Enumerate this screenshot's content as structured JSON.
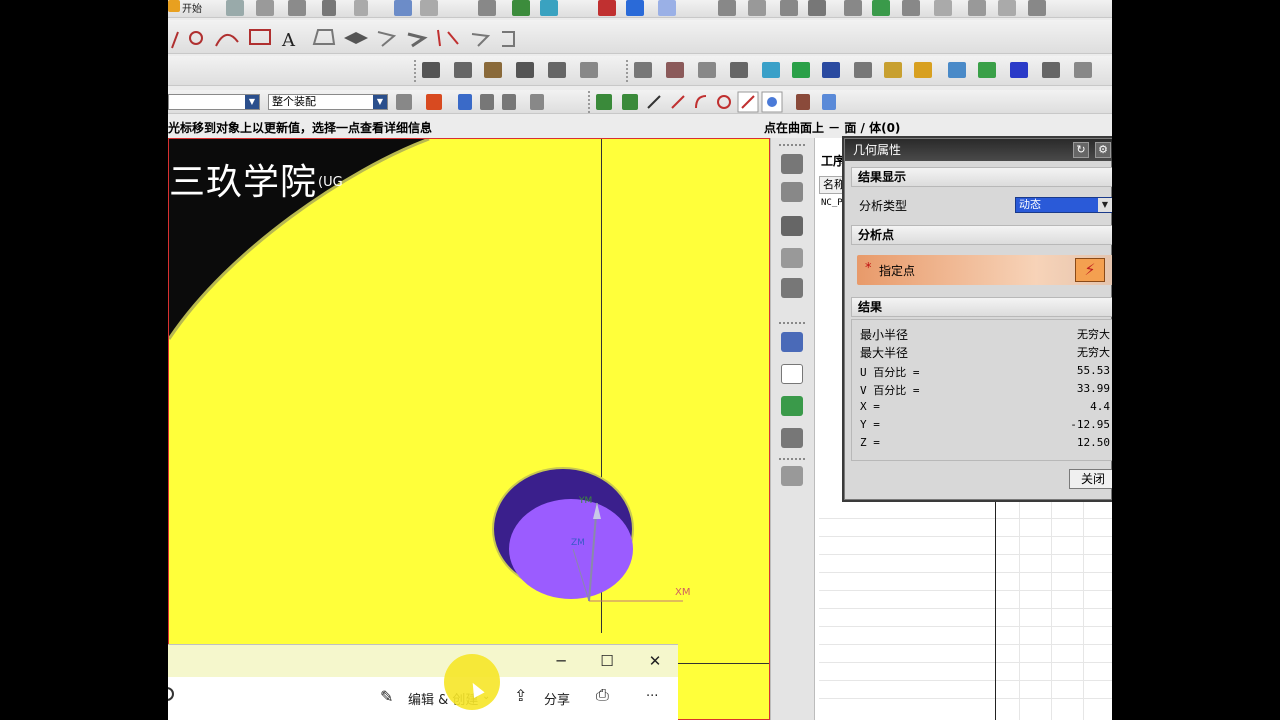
{
  "menu": {
    "start_label": "开始"
  },
  "toolbar": {
    "assembly_combo": "整个装配"
  },
  "status": {
    "left_message": "光标移到对象上以更新值，选择一点查看详细信息",
    "right_message": "点在曲面上 － 面 / 体(0)"
  },
  "viewport": {
    "brand_text": "三玖学院",
    "brand_sub": "(UG"
  },
  "navigator": {
    "title": "工序",
    "col_name": "名称",
    "row0": "NC_P"
  },
  "dialog": {
    "title": "几何属性",
    "section_result_display": "结果显示",
    "analysis_type_label": "分析类型",
    "analysis_type_value": "动态",
    "section_analysis_point": "分析点",
    "specify_point_label": "指定点",
    "section_result": "结果",
    "results": [
      {
        "label": "最小半径",
        "value": "无穷大"
      },
      {
        "label": "最大半径",
        "value": "无穷大"
      },
      {
        "label": "U 百分比 =",
        "value": "55.53"
      },
      {
        "label": "V 百分比 =",
        "value": "33.99"
      },
      {
        "label": "X =",
        "value": "4.4"
      },
      {
        "label": "Y =",
        "value": "-12.95"
      },
      {
        "label": "Z =",
        "value": "12.50"
      }
    ],
    "close_label": "关闭"
  },
  "overlay": {
    "minimize": "─",
    "maximize": "☐",
    "close": "✕",
    "edit_create": "编辑 & 创建",
    "share": "分享",
    "more": "···"
  },
  "colors": {
    "viewport_bg": "#ffff3a",
    "cylinder": "#9b5cff",
    "cylinder_dark": "#3a1f8c"
  }
}
